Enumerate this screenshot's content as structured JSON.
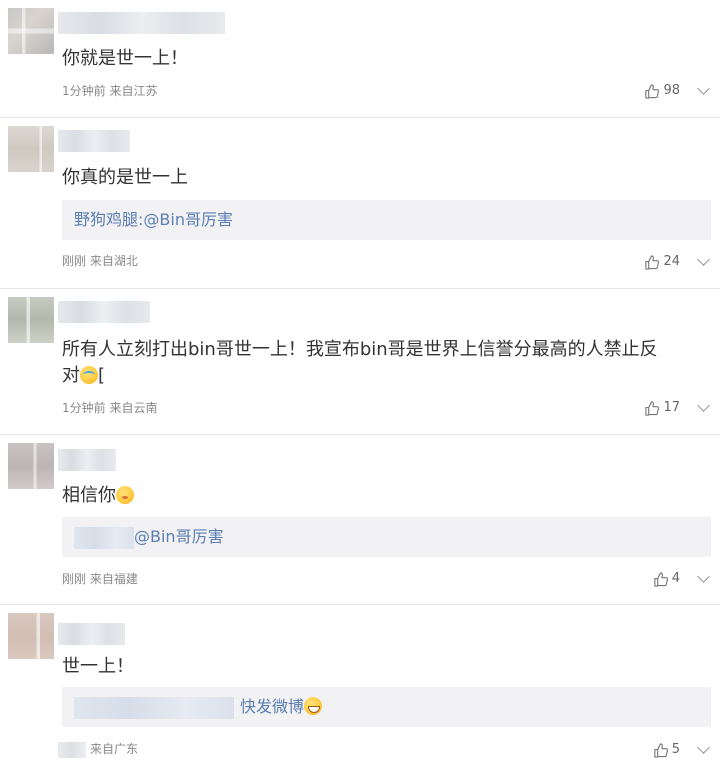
{
  "comments": [
    {
      "text": "你就是世一上！",
      "meta": "1分钟前 来自江苏",
      "likes": "98"
    },
    {
      "text": "你真的是世一上",
      "quote": "野狗鸡腿:@Bin哥厉害",
      "meta": "刚刚 来自湖北",
      "likes": "24"
    },
    {
      "text_line1": "所有人立刻打出bin哥世一上！我宣布bin哥是世界上信誉分最高的人禁止反",
      "text_line2_before": "对",
      "text_line2_after": "[",
      "meta": "1分钟前 来自云南",
      "likes": "17"
    },
    {
      "text": "相信你",
      "quote": "@Bin哥厉害",
      "meta": "刚刚 来自福建",
      "likes": "4"
    },
    {
      "text": "世一上！",
      "quote": "快发微博",
      "meta": "来自广东",
      "likes": "5"
    }
  ],
  "icons": {
    "like": "thumbs-up-icon",
    "more": "chevron-down-icon"
  },
  "colors": {
    "link": "#5b7eb1",
    "meta": "#888888",
    "quote_bg": "#f2f2f5"
  }
}
